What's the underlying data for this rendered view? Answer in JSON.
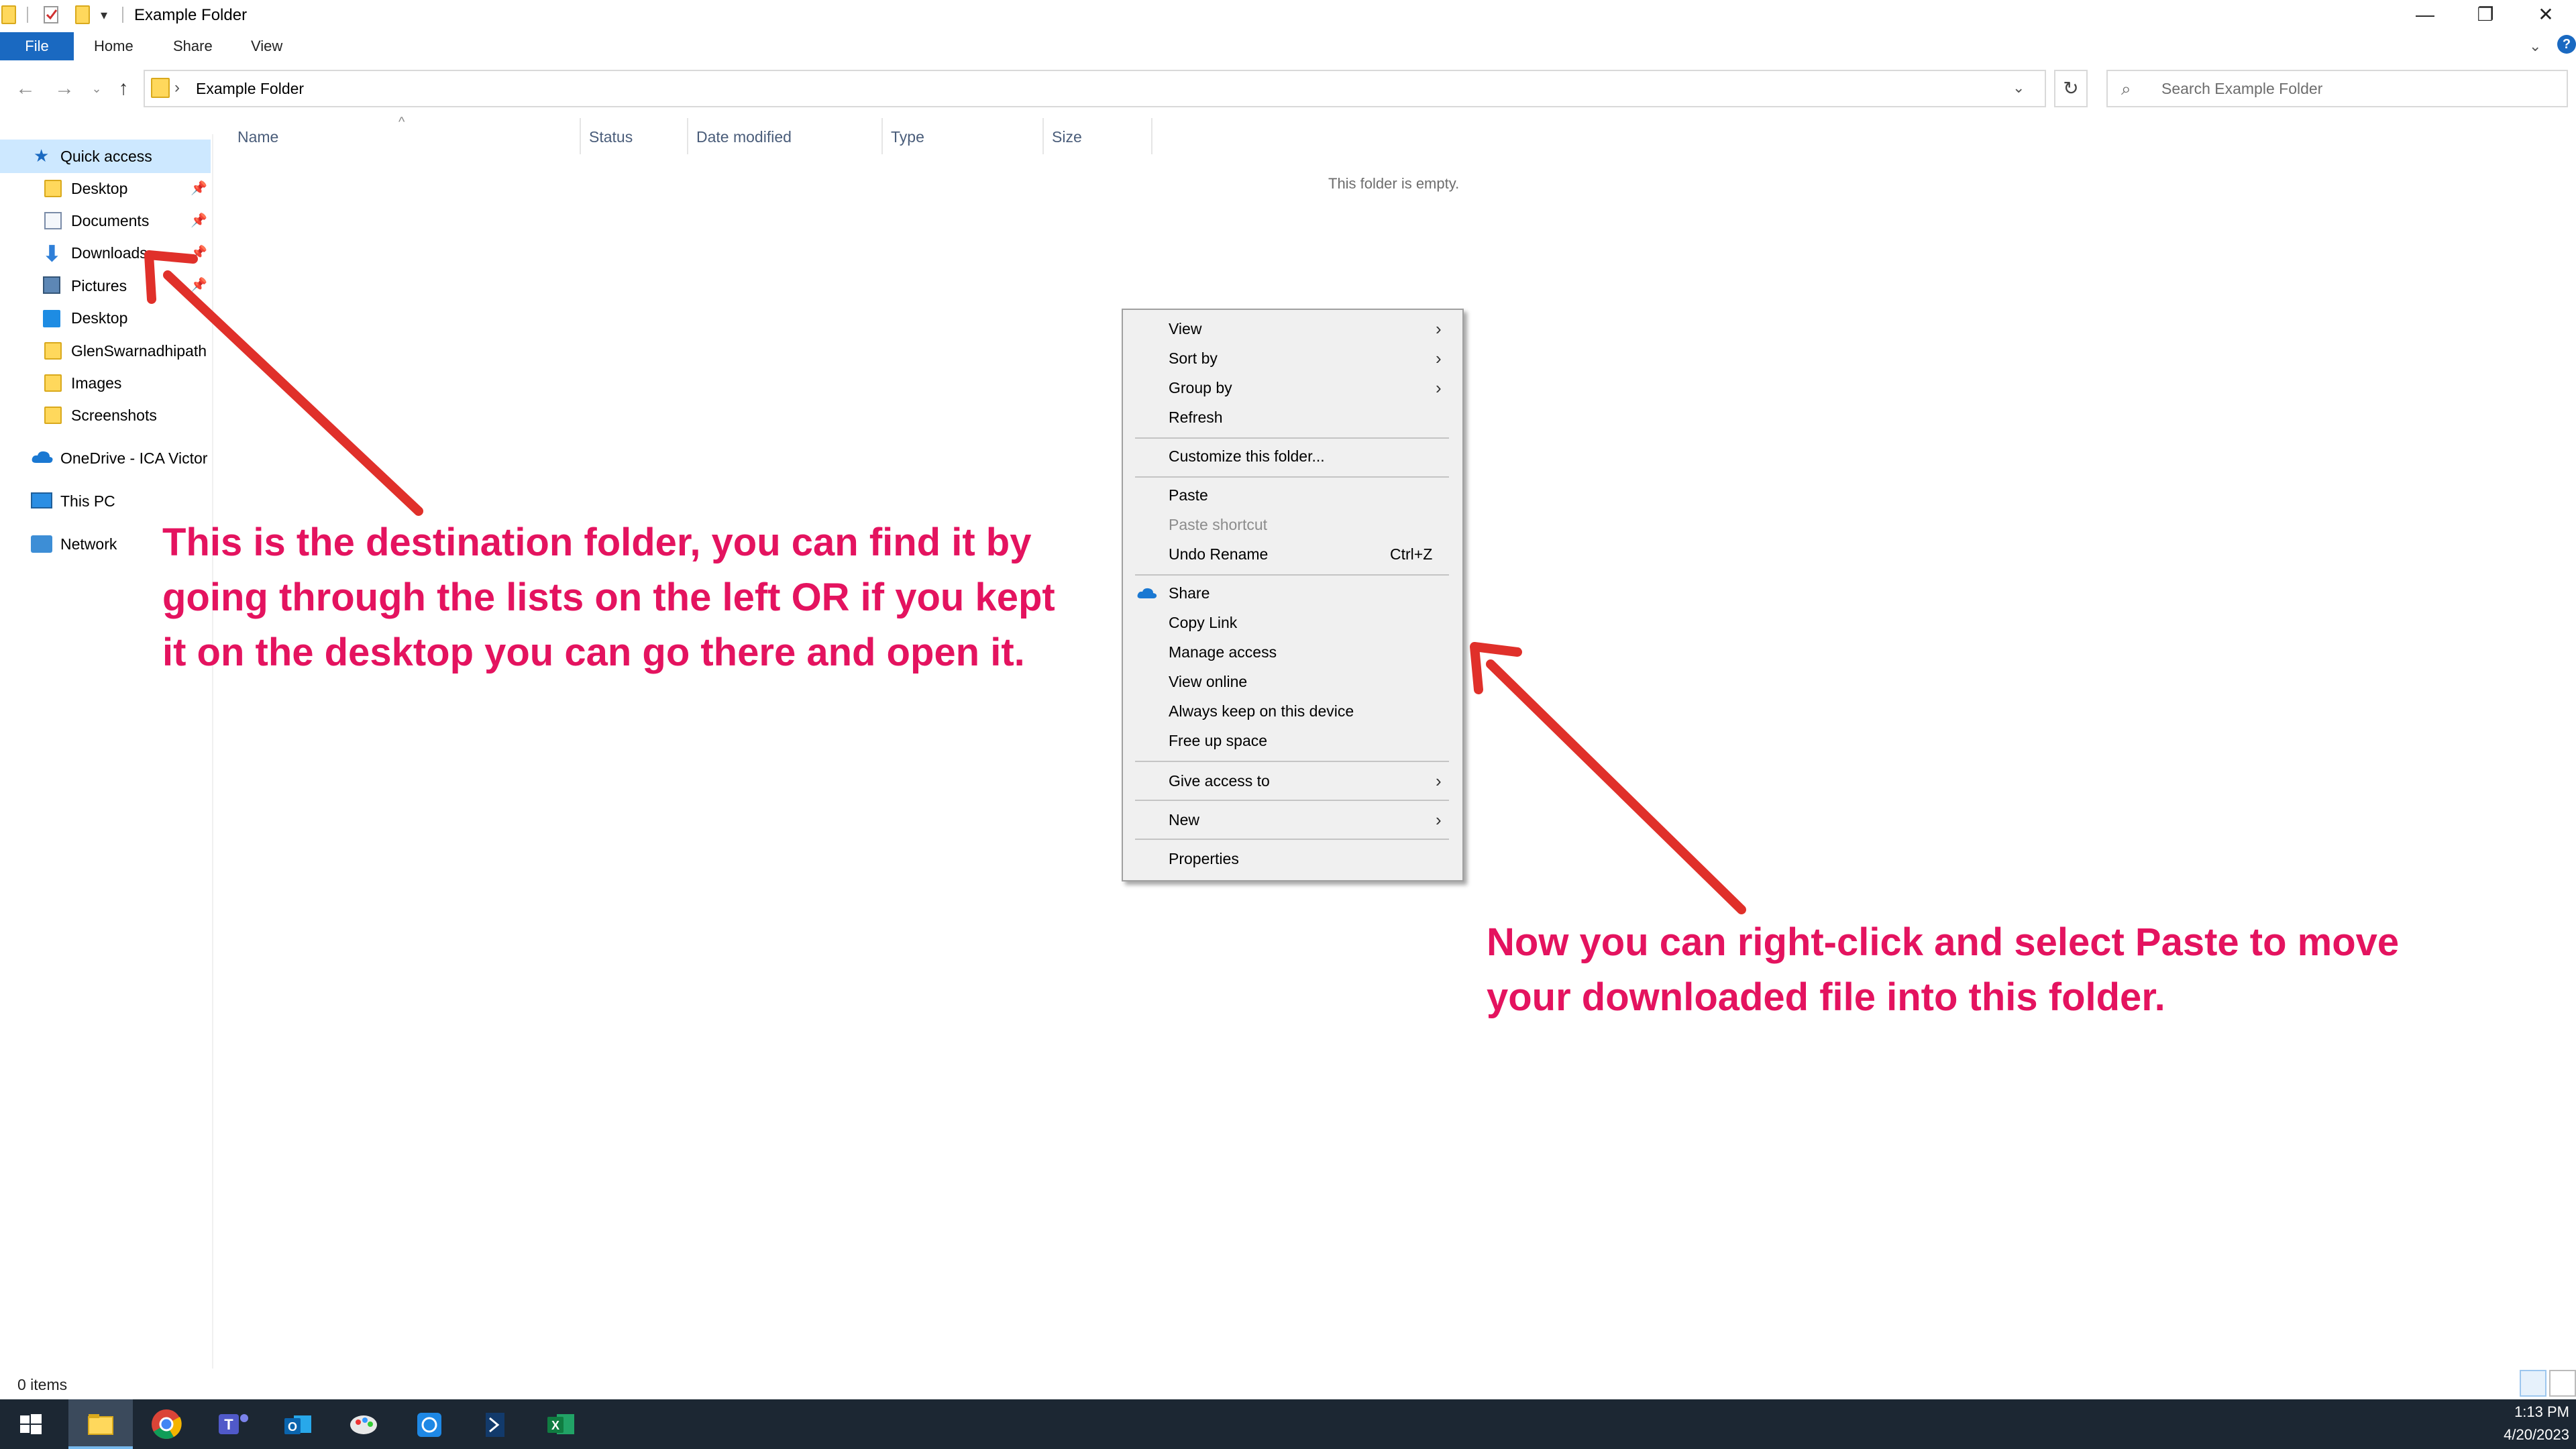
{
  "window": {
    "title": "Example Folder",
    "controls": {
      "minimize": "—",
      "restore": "❐",
      "close": "✕"
    }
  },
  "ribbon": {
    "tabs": [
      "File",
      "Home",
      "Share",
      "View"
    ]
  },
  "address": {
    "path": "Example Folder",
    "search_placeholder": "Search Example Folder"
  },
  "nav": {
    "quick_access": "Quick access",
    "items": [
      "Desktop",
      "Documents",
      "Downloads",
      "Pictures",
      "Desktop",
      "GlenSwarnadhipath",
      "Images",
      "Screenshots"
    ],
    "onedrive": "OneDrive - ICA Victor",
    "this_pc": "This PC",
    "network": "Network"
  },
  "columns": [
    "Name",
    "Status",
    "Date modified",
    "Type",
    "Size"
  ],
  "content": {
    "empty_message": "This folder is empty."
  },
  "context_menu": {
    "items": [
      {
        "label": "View",
        "submenu": true
      },
      {
        "label": "Sort by",
        "submenu": true
      },
      {
        "label": "Group by",
        "submenu": true
      },
      {
        "label": "Refresh"
      },
      {
        "label": "Customize this folder..."
      },
      {
        "label": "Paste"
      },
      {
        "label": "Paste shortcut",
        "disabled": true
      },
      {
        "label": "Undo Rename",
        "shortcut": "Ctrl+Z"
      },
      {
        "label": "Share",
        "icon": "onedrive-cloud-icon"
      },
      {
        "label": "Copy Link"
      },
      {
        "label": "Manage access"
      },
      {
        "label": "View online"
      },
      {
        "label": "Always keep on this device"
      },
      {
        "label": "Free up space"
      },
      {
        "label": "Give access to",
        "submenu": true
      },
      {
        "label": "New",
        "submenu": true
      },
      {
        "label": "Properties"
      }
    ]
  },
  "annotations": {
    "left": [
      "This is the destination folder, you can find it by",
      "going through the lists on the left OR if you kept",
      "it on the desktop you can go there and open it."
    ],
    "right": [
      "Now you can right-click and select Paste to move",
      "your downloaded file into this folder."
    ],
    "color": "#e4135f",
    "arrow_color": "#e0302a"
  },
  "status": {
    "items_count": "0 items"
  },
  "taskbar": {
    "apps": [
      "start-icon",
      "file-explorer-icon",
      "chrome-icon",
      "teams-icon",
      "outlook-icon",
      "paint-icon",
      "app-icon",
      "powershell-icon",
      "excel-icon"
    ],
    "time": "1:13 PM",
    "date": "4/20/2023"
  },
  "colors": {
    "accent": "#1a69c1",
    "selection": "#cde8ff",
    "taskbar": "#1c2733"
  }
}
